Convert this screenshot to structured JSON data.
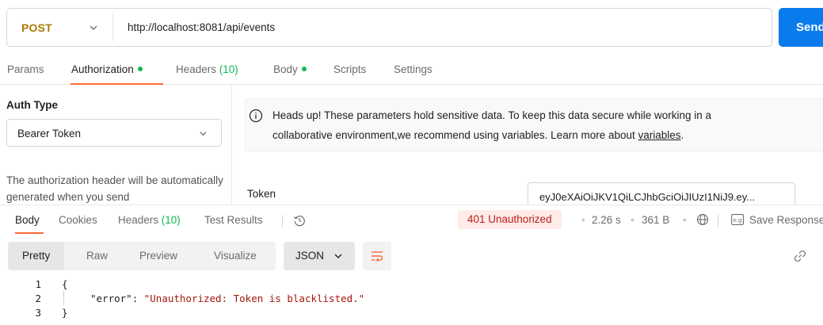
{
  "request": {
    "method": "POST",
    "url": "http://localhost:8081/api/events",
    "send_label": "Send"
  },
  "request_tabs": [
    {
      "label": "Params",
      "active": false
    },
    {
      "label": "Authorization",
      "active": true,
      "dot": true
    },
    {
      "label": "Headers",
      "count": "(10)",
      "active": false
    },
    {
      "label": "Body",
      "active": false,
      "dot": true
    },
    {
      "label": "Scripts",
      "active": false
    },
    {
      "label": "Settings",
      "active": false
    }
  ],
  "auth": {
    "type_label": "Auth Type",
    "type_value": "Bearer Token",
    "description": "The authorization header will be automatically generated when you send",
    "notice_line1": "Heads up! These parameters hold sensitive data. To keep this data secure while working in a",
    "notice_line2_prefix": "collaborative environment,we recommend using variables. Learn more about ",
    "notice_link": "variables",
    "notice_line2_suffix": ".",
    "token_label": "Token",
    "token_value": "eyJ0eXAiOiJKV1QiLCJhbGciOiJIUzI1NiJ9.ey..."
  },
  "response_tabs": [
    {
      "label": "Body",
      "active": true
    },
    {
      "label": "Cookies",
      "active": false
    },
    {
      "label": "Headers",
      "count": "(10)",
      "active": false
    },
    {
      "label": "Test Results",
      "active": false
    }
  ],
  "response_meta": {
    "status": "401 Unauthorized",
    "time": "2.26 s",
    "size": "361 B",
    "save_label": "Save Response"
  },
  "response_view": {
    "modes": [
      "Pretty",
      "Raw",
      "Preview",
      "Visualize"
    ],
    "active_mode": "Pretty",
    "format": "JSON"
  },
  "response_body": {
    "lines": [
      {
        "num": "1",
        "text": "{"
      },
      {
        "num": "2",
        "key": "\"error\"",
        "sep": ": ",
        "value": "\"Unauthorized: Token is blacklisted.\""
      },
      {
        "num": "3",
        "text": "}"
      }
    ]
  },
  "icons": {
    "method_chevron": "chevron-down-icon",
    "auth_chevron": "chevron-down-icon",
    "info": "info-icon",
    "history": "history-icon",
    "globe": "globe-icon",
    "save": "save-response-icon",
    "wrap": "wrap-lines-icon",
    "link": "link-icon"
  },
  "colors": {
    "method": "#ad7a03",
    "send": "#097bed",
    "accent": "#ff6c37",
    "dot": "#0cbb52",
    "status_bg": "#ffebe7",
    "status_text": "#b91d1d",
    "json_string": "#a4180b"
  }
}
